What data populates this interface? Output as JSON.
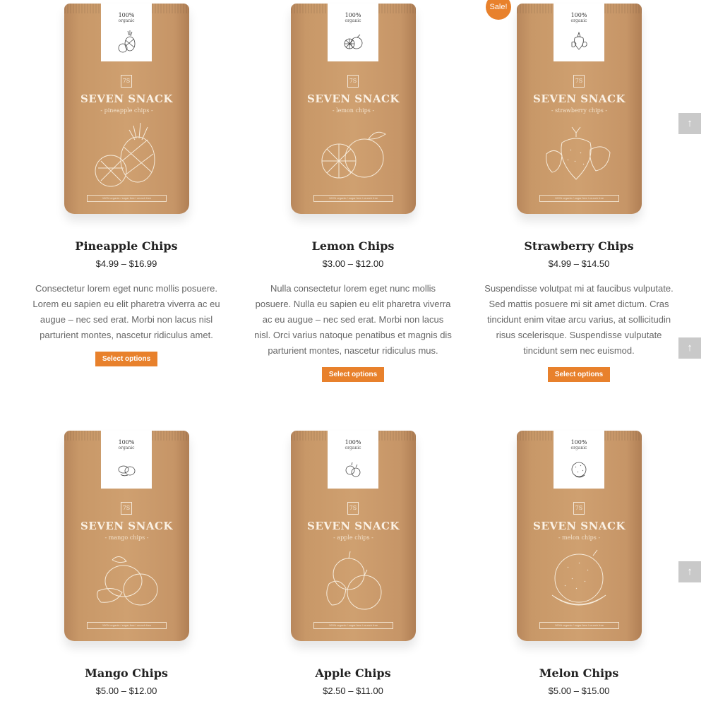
{
  "products": [
    {
      "name": "Pineapple Chips",
      "price": "$4.99 – $16.99",
      "description": "Consectetur lorem eget nunc mollis posuere. Lorem eu sapien eu elit pharetra viverra ac eu augue – nec sed erat. Morbi non lacus nisl parturient montes, nascetur ridiculus amet.",
      "button": "Select options",
      "bag": {
        "pct": "100%",
        "organic": "organic",
        "brand": "SEVEN SNACK",
        "flavor": "- pineapple chips -",
        "logo": "7S",
        "footer": "100% organic / sugar free / crunch free",
        "fruit_icon": "pineapple-icon"
      }
    },
    {
      "name": "Lemon Chips",
      "price": "$3.00 – $12.00",
      "description": "Nulla consectetur lorem eget nunc mollis posuere. Nulla eu sapien eu elit pharetra viverra ac eu augue – nec sed erat. Morbi non lacus nisl. Orci varius natoque penatibus et magnis dis parturient montes, nascetur ridiculus mus.",
      "button": "Select options",
      "bag": {
        "pct": "100%",
        "organic": "organic",
        "brand": "SEVEN SNACK",
        "flavor": "- lemon chips -",
        "logo": "7S",
        "footer": "100% organic / sugar free / crunch free",
        "fruit_icon": "lemon-icon"
      }
    },
    {
      "name": "Strawberry Chips",
      "price": "$4.99 – $14.50",
      "description": "Suspendisse volutpat mi at faucibus vulputate. Sed mattis posuere mi sit amet dictum. Cras tincidunt enim vitae arcu varius, at sollicitudin risus scelerisque. Suspendisse vulputate tincidunt sem nec euismod.",
      "button": "Select options",
      "sale": "Sale!",
      "bag": {
        "pct": "100%",
        "organic": "organic",
        "brand": "SEVEN SNACK",
        "flavor": "- strawberry chips -",
        "logo": "7S",
        "footer": "100% organic / sugar free / crunch free",
        "fruit_icon": "strawberry-icon"
      }
    },
    {
      "name": "Mango Chips",
      "price": "$5.00 – $12.00",
      "bag": {
        "pct": "100%",
        "organic": "organic",
        "brand": "SEVEN SNACK",
        "flavor": "- mango chips -",
        "logo": "7S",
        "footer": "100% organic / sugar free / crunch free",
        "fruit_icon": "mango-icon"
      }
    },
    {
      "name": "Apple Chips",
      "price": "$2.50 – $11.00",
      "bag": {
        "pct": "100%",
        "organic": "organic",
        "brand": "SEVEN SNACK",
        "flavor": "- apple chips -",
        "logo": "7S",
        "footer": "100% organic / sugar free / crunch free",
        "fruit_icon": "apple-icon"
      }
    },
    {
      "name": "Melon Chips",
      "price": "$5.00 – $15.00",
      "bag": {
        "pct": "100%",
        "organic": "organic",
        "brand": "SEVEN SNACK",
        "flavor": "- melon chips -",
        "logo": "7S",
        "footer": "100% organic / sugar free / crunch free",
        "fruit_icon": "melon-icon"
      }
    }
  ],
  "scroll_top": {
    "icon": "arrow-up-icon",
    "glyph": "↑"
  },
  "colors": {
    "accent": "#e8812c",
    "kraft": "#cfa070",
    "scroll_button": "#c9c9c9"
  }
}
